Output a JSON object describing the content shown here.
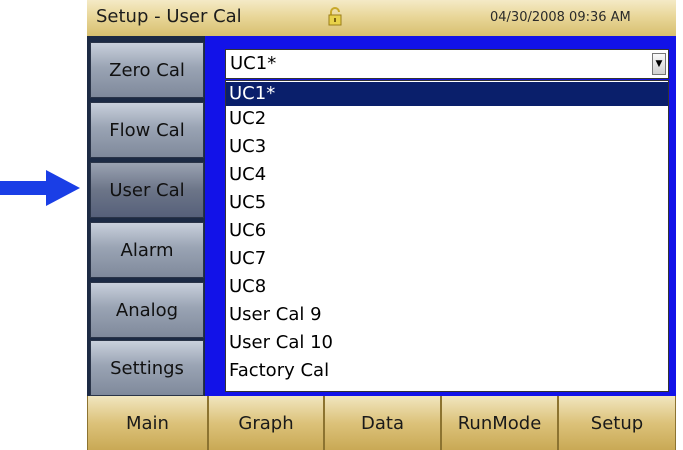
{
  "titlebar": {
    "title": "Setup - User Cal",
    "datetime": "04/30/2008 09:36 AM"
  },
  "sidebar": {
    "items": [
      {
        "label": "Zero Cal"
      },
      {
        "label": "Flow Cal"
      },
      {
        "label": "User Cal"
      },
      {
        "label": "Alarm"
      },
      {
        "label": "Analog"
      },
      {
        "label": "Settings"
      }
    ],
    "active": "User Cal"
  },
  "calibration_select": {
    "value": "UC1*",
    "options": [
      "UC1*",
      "UC2",
      "UC3",
      "UC4",
      "UC5",
      "UC6",
      "UC7",
      "UC8",
      "User Cal 9",
      "User Cal 10",
      "Factory Cal"
    ],
    "highlighted": "UC1*"
  },
  "bottombar": {
    "items": [
      {
        "label": "Main"
      },
      {
        "label": "Graph"
      },
      {
        "label": "Data"
      },
      {
        "label": "RunMode"
      },
      {
        "label": "Setup"
      }
    ]
  },
  "colors": {
    "panel_blue": "#1212e8",
    "highlight": "#0a1f6b",
    "pointer_arrow": "#1a3ee6"
  },
  "icons": [
    "lock-icon",
    "dropdown-arrow-icon",
    "pointer-arrow-icon"
  ]
}
